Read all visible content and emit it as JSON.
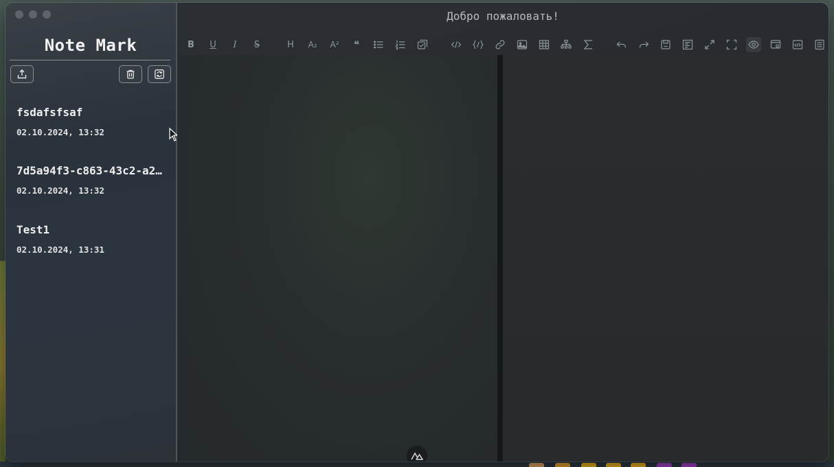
{
  "window": {
    "header_title": "Добро пожаловать!"
  },
  "sidebar": {
    "app_title": "Note Mark",
    "buttons": [
      {
        "name": "export",
        "icon": "upload-icon"
      },
      {
        "name": "delete",
        "icon": "trash-icon"
      },
      {
        "name": "refresh",
        "icon": "refresh-icon"
      }
    ],
    "notes": [
      {
        "title": "fsdafsfsaf",
        "date": "02.10.2024, 13:32"
      },
      {
        "title": "7d5a94f3-c863-43c2-a2…",
        "date": "02.10.2024, 13:32"
      },
      {
        "title": "Test1",
        "date": "02.10.2024, 13:31"
      }
    ]
  },
  "toolbar": {
    "items": [
      {
        "name": "bold",
        "icon": "bold-icon",
        "glyph": "B"
      },
      {
        "name": "underline",
        "icon": "underline-icon",
        "glyph": "U"
      },
      {
        "name": "italic",
        "icon": "italic-icon",
        "glyph": "I"
      },
      {
        "name": "strikethrough",
        "icon": "strikethrough-icon",
        "glyph": "S"
      },
      {
        "name": "heading",
        "icon": "heading-icon",
        "glyph": "H"
      },
      {
        "name": "subscript",
        "icon": "subscript-icon",
        "glyph": "A₂"
      },
      {
        "name": "superscript",
        "icon": "superscript-icon",
        "glyph": "A²"
      },
      {
        "name": "quote",
        "icon": "quote-icon",
        "glyph": "❝"
      },
      {
        "name": "unordered-list",
        "icon": "unordered-list-icon"
      },
      {
        "name": "ordered-list",
        "icon": "ordered-list-icon"
      },
      {
        "name": "task",
        "icon": "task-icon"
      },
      {
        "name": "code-row",
        "icon": "code-row-icon"
      },
      {
        "name": "code-block",
        "icon": "code-block-icon"
      },
      {
        "name": "link",
        "icon": "link-icon"
      },
      {
        "name": "image",
        "icon": "image-icon"
      },
      {
        "name": "table",
        "icon": "table-icon"
      },
      {
        "name": "mermaid",
        "icon": "mermaid-icon"
      },
      {
        "name": "katex",
        "icon": "sigma-icon"
      },
      {
        "name": "revoke",
        "icon": "undo-icon"
      },
      {
        "name": "next",
        "icon": "redo-icon"
      },
      {
        "name": "save",
        "icon": "save-icon"
      },
      {
        "name": "pretty",
        "icon": "prettier-icon"
      },
      {
        "name": "page-fullscreen",
        "icon": "expand-icon"
      },
      {
        "name": "fullscreen",
        "icon": "fullscreen-icon"
      },
      {
        "name": "preview",
        "icon": "eye-icon"
      },
      {
        "name": "preview-only",
        "icon": "preview-only-icon"
      },
      {
        "name": "html-preview",
        "icon": "html-preview-icon"
      },
      {
        "name": "catalog",
        "icon": "catalog-icon"
      }
    ]
  }
}
